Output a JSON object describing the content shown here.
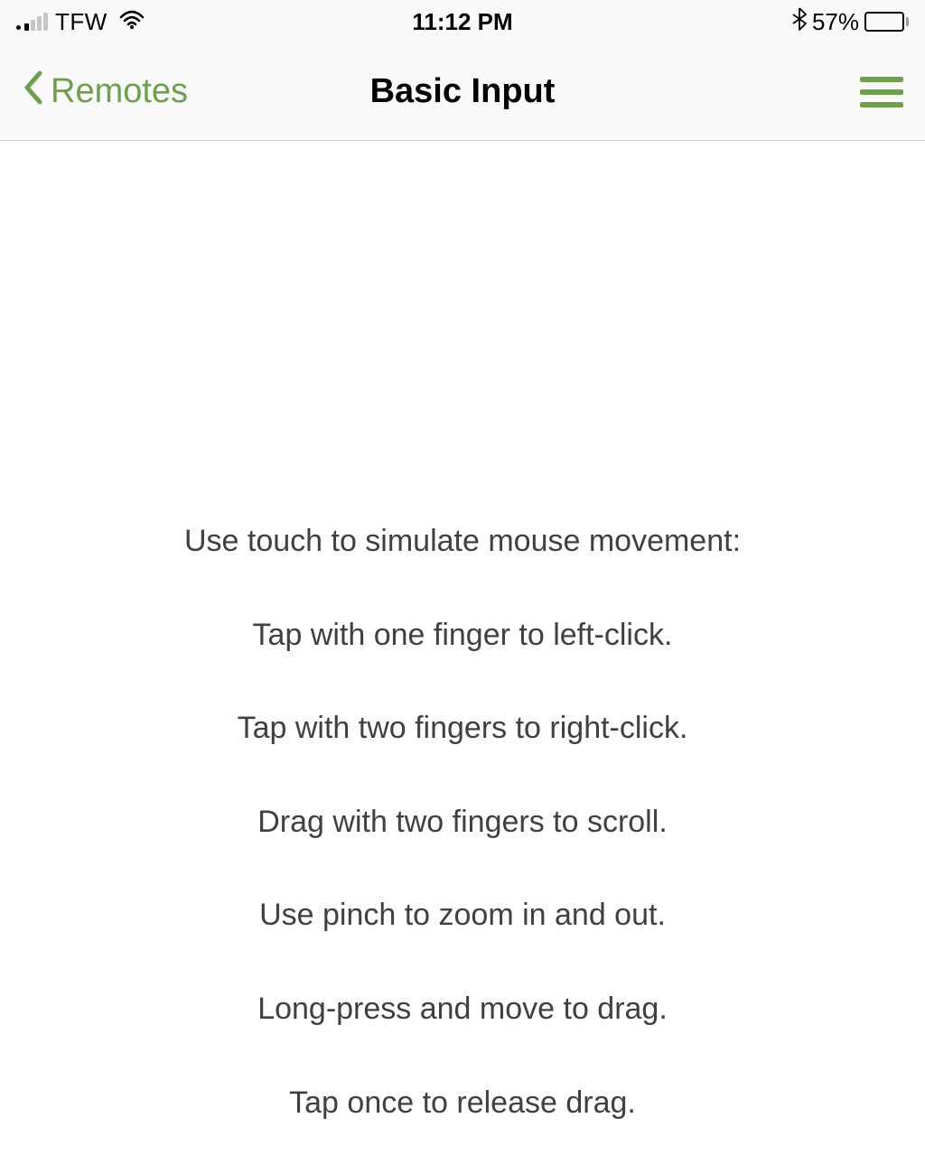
{
  "status_bar": {
    "carrier": "TFW",
    "time": "11:12 PM",
    "battery_percent": "57%"
  },
  "nav": {
    "back_label": "Remotes",
    "title": "Basic Input"
  },
  "instructions": {
    "line1": "Use touch to simulate mouse movement:",
    "line2": "Tap with one finger to left-click.",
    "line3": "Tap with two fingers to right-click.",
    "line4": "Drag with two fingers to scroll.",
    "line5": "Use pinch to zoom in and out.",
    "line6": "Long-press and move to drag.",
    "line7": "Tap once to release drag."
  }
}
